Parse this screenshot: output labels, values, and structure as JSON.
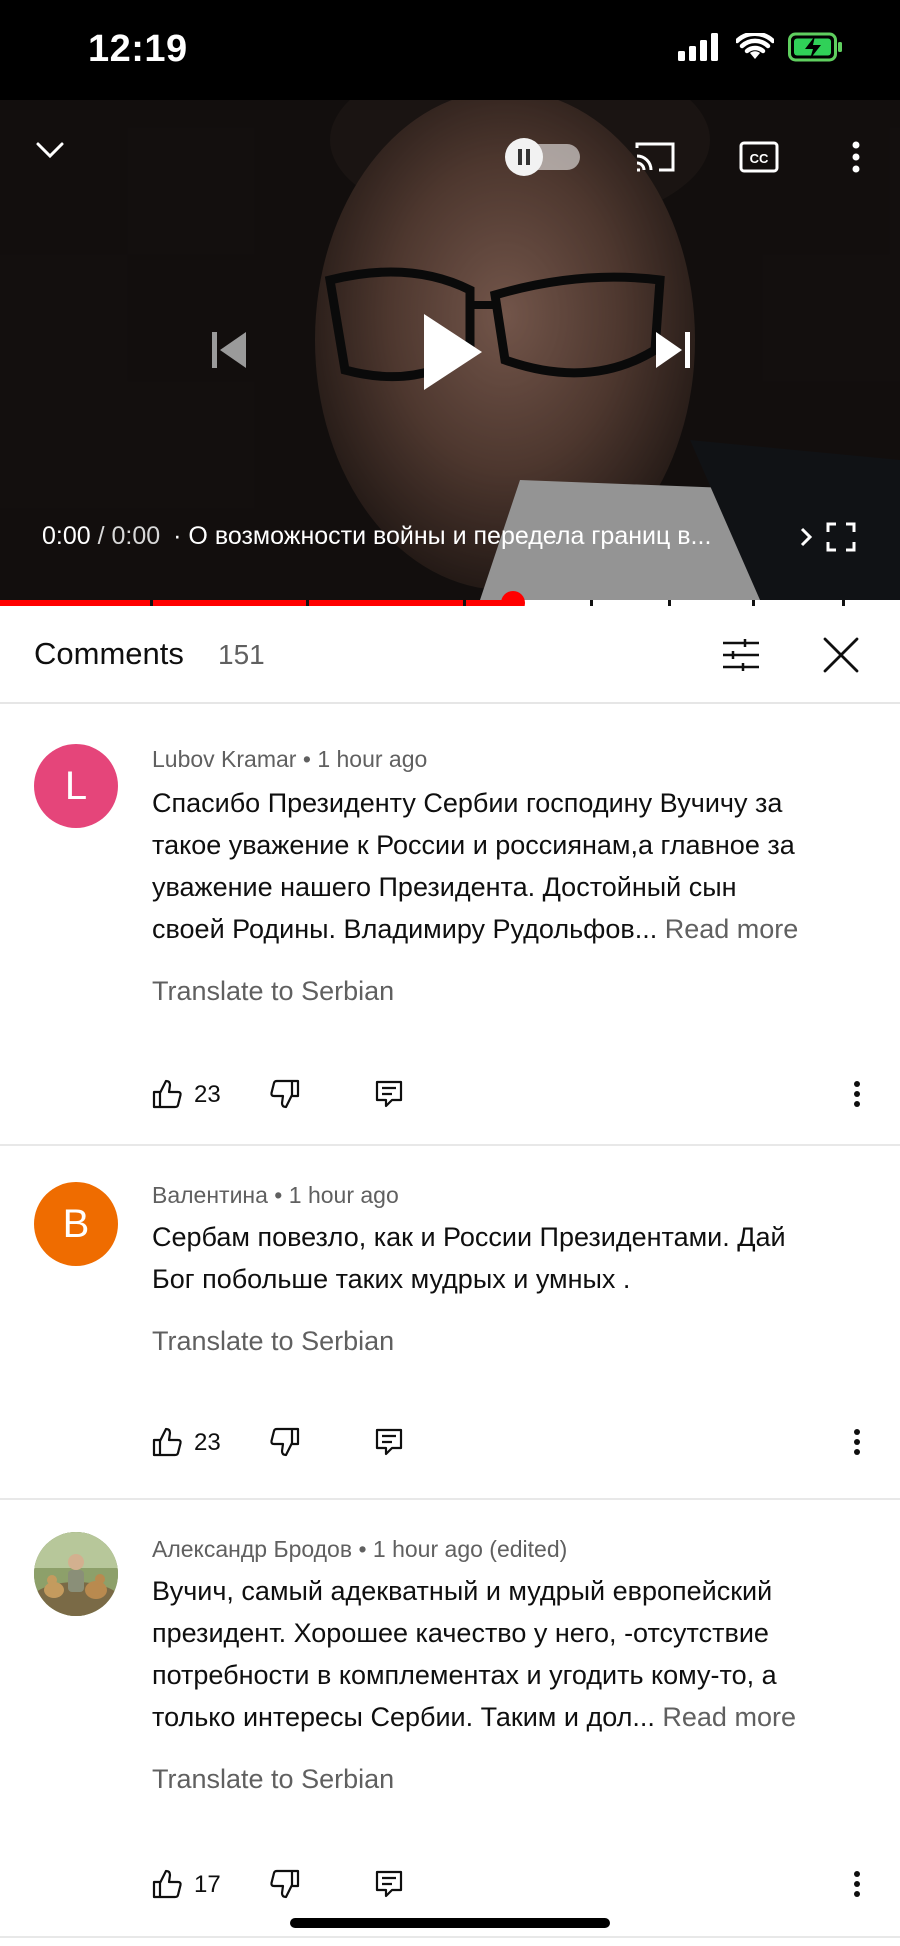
{
  "status_bar": {
    "time": "12:19"
  },
  "player": {
    "time_current": "0:00",
    "time_separator": "/",
    "time_total": "0:00",
    "title": "· О возможности войны и передела границ в...",
    "progress_fraction": 0.57
  },
  "comments_header": {
    "title": "Comments",
    "count": "151"
  },
  "comments": [
    {
      "avatar_letter": "L",
      "avatar_color": "#e5457a",
      "author": "Lubov Kramar",
      "time": "1 hour ago",
      "lines": [
        "Спасибо Президенту Сербии  господину Вучичу за",
        "такое уважение к России и россиянам,а главное за",
        "уважение нашего Президента. Достойный сын",
        "своей Родины. Владимиру Рудольфов..."
      ],
      "read_more": "Read more",
      "translate": "Translate to Serbian",
      "likes": "23"
    },
    {
      "avatar_letter": "В",
      "avatar_color": "#ef6c00",
      "author": "Валентина",
      "time": "1 hour ago",
      "lines": [
        "Сербам повезло, как и России Президентами. Дай",
        "Бог побольше таких мудрых и умных ."
      ],
      "translate": "Translate to Serbian",
      "likes": "23"
    },
    {
      "avatar_letter": "",
      "avatar_color": "#7e8a5c",
      "author": "Александр Бродов",
      "time": "1 hour ago (edited)",
      "lines": [
        "Вучич, самый адекватный и мудрый европейский",
        "президент. Хорошее качество у  него, -отсутствие",
        "потребности  в комплементах и угодить кому-то, а",
        "только интересы Сербии. Таким и дол..."
      ],
      "read_more": "Read more",
      "translate": "Translate to Serbian",
      "likes": "17"
    }
  ]
}
